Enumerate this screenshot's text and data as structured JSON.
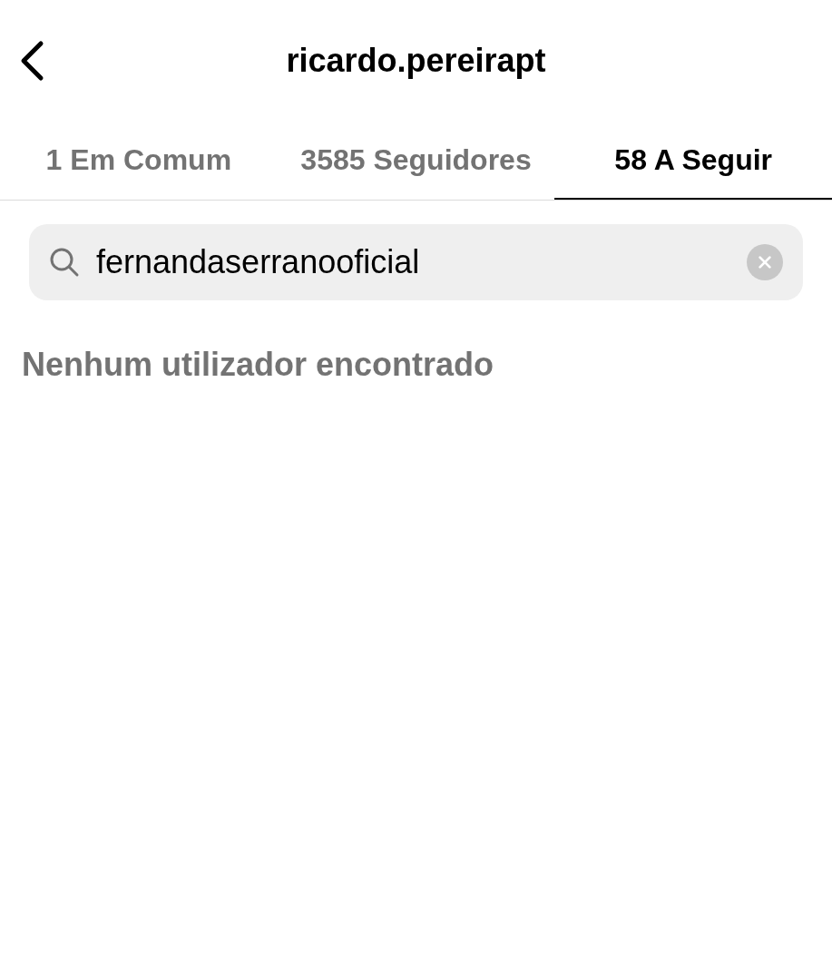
{
  "header": {
    "title": "ricardo.pereirapt"
  },
  "tabs": [
    {
      "label": "1 Em Comum",
      "selected": false
    },
    {
      "label": "3585 Seguidores",
      "selected": false
    },
    {
      "label": "58 A Seguir",
      "selected": true
    }
  ],
  "search": {
    "value": "fernandaserranooficial"
  },
  "message": "Nenhum utilizador encontrado"
}
